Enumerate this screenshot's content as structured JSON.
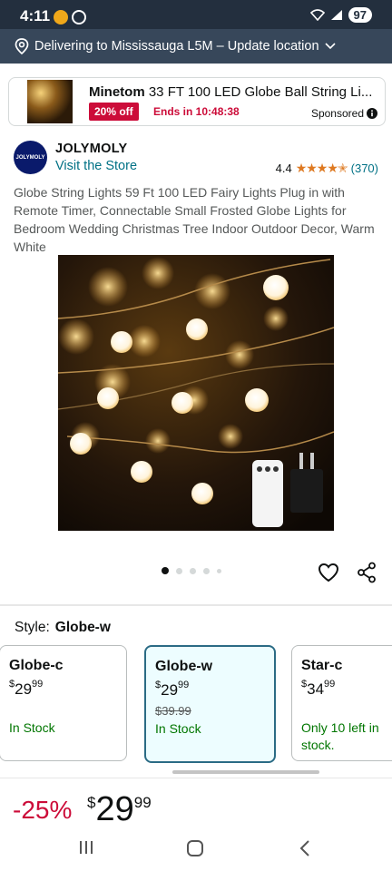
{
  "status": {
    "time": "4:11",
    "battery": "97"
  },
  "delivery": {
    "text": "Delivering to Mississauga L5M – Update location"
  },
  "ad": {
    "brand": "Minetom",
    "title_rest": " 33 FT 100 LED Globe Ball String Li...",
    "badge": "20% off",
    "ends": "Ends in 10:48:38",
    "sponsored": "Sponsored"
  },
  "store": {
    "brand": "JOLYMOLY",
    "logo_text": "JOLYMOLY",
    "visit": "Visit the Store",
    "rating_value": "4.4",
    "stars": "★★★★✭",
    "rating_count": "(370)"
  },
  "product": {
    "title": "Globe String Lights 59 Ft 100 LED Fairy Lights Plug in with Remote Timer, Connectable Small Frosted Globe Lights for Bedroom Wedding Christmas Tree Indoor Outdoor Decor, Warm White",
    "image_count": 5,
    "active_image": 0
  },
  "style": {
    "label": "Style:",
    "selected": "Globe-w",
    "options": [
      {
        "name": "Globe-c",
        "price_sym": "$",
        "price_whole": "29",
        "price_cents": "99",
        "was": "",
        "stock": "In Stock"
      },
      {
        "name": "Globe-w",
        "price_sym": "$",
        "price_whole": "29",
        "price_cents": "99",
        "was": "$39.99",
        "stock": "In Stock"
      },
      {
        "name": "Star-c",
        "price_sym": "$",
        "price_whole": "34",
        "price_cents": "99",
        "was": "",
        "stock": "Only 10 left in stock."
      }
    ]
  },
  "price": {
    "discount": "-25%",
    "symbol": "$",
    "whole": "29",
    "cents": "99"
  },
  "colors": {
    "link": "#007185",
    "deal_red": "#cc0c39",
    "in_stock": "#007600",
    "star": "#de7921",
    "header": "#232f3e"
  }
}
